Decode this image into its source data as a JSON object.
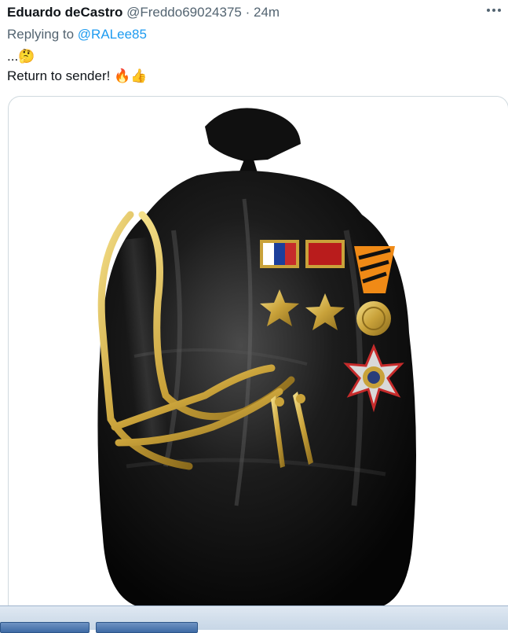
{
  "tweet": {
    "author_name": "Eduardo deCastro",
    "author_handle": "@Freddo69024375",
    "separator": "·",
    "timestamp": "24m",
    "replying_prefix": "Replying to",
    "replying_to": "@RALee85",
    "line1_text": "...",
    "line1_emoji": "🤔",
    "line2_text": "Return to sender!",
    "line2_emoji": "🔥👍"
  },
  "colors": {
    "link": "#1d9bf0",
    "secondary_text": "#536471",
    "primary_text": "#0f1419"
  },
  "icons": [
    "more-options-icon"
  ]
}
